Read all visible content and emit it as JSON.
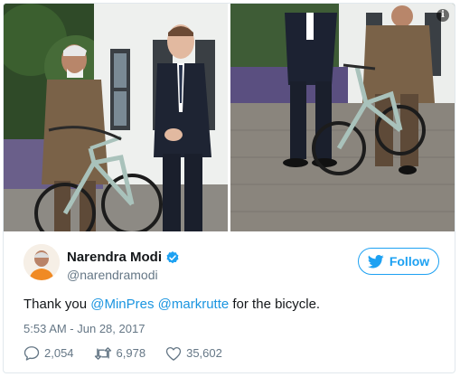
{
  "tweet": {
    "author": {
      "display_name": "Narendra Modi",
      "handle": "@narendramodi",
      "verified": true
    },
    "follow_button": {
      "label": "Follow",
      "icon": "bird-icon"
    },
    "text": {
      "prefix": "Thank you ",
      "mention_1": "@MinPres",
      "space": " ",
      "mention_2": "@markrutte",
      "suffix": " for the bicycle."
    },
    "timestamp": "5:53 AM - Jun 28, 2017",
    "stats": {
      "replies": "2,054",
      "retweets": "6,978",
      "likes": "35,602"
    },
    "info_icon": "i"
  },
  "colors": {
    "accent": "#1da1f2",
    "mention": "#1b95e0",
    "text": "#14171a",
    "muted": "#657786",
    "border": "#e1e8ed"
  }
}
